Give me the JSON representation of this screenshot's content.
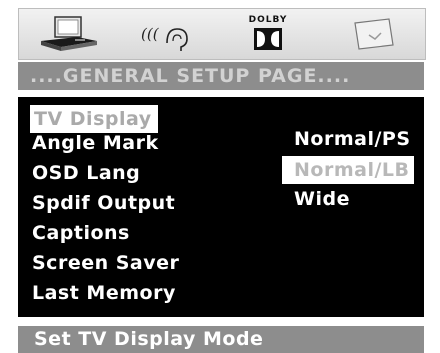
{
  "toolbar": {
    "icons": [
      {
        "name": "general-setup-icon"
      },
      {
        "name": "audio-setup-icon"
      },
      {
        "name": "dolby-digital-setup-icon",
        "label": "DOLBY"
      },
      {
        "name": "preference-setup-icon"
      }
    ]
  },
  "page": {
    "title": "....GENERAL SETUP PAGE...."
  },
  "menu": {
    "items": [
      {
        "label": "TV Display",
        "selected": true
      },
      {
        "label": "Angle Mark"
      },
      {
        "label": "OSD Lang"
      },
      {
        "label": "Spdif Output"
      },
      {
        "label": "Captions"
      },
      {
        "label": "Screen Saver"
      },
      {
        "label": "Last Memory"
      }
    ]
  },
  "submenu": {
    "options": [
      {
        "label": "Normal/PS"
      },
      {
        "label": "Normal/LB",
        "selected": true
      },
      {
        "label": "Wide"
      }
    ]
  },
  "footer": {
    "status": "Set TV Display Mode"
  },
  "colors": {
    "bar_gray": "#8d8d8d",
    "panel_black": "#000000",
    "highlight": "#ffffff",
    "highlight_text": "#aaaaaa"
  }
}
